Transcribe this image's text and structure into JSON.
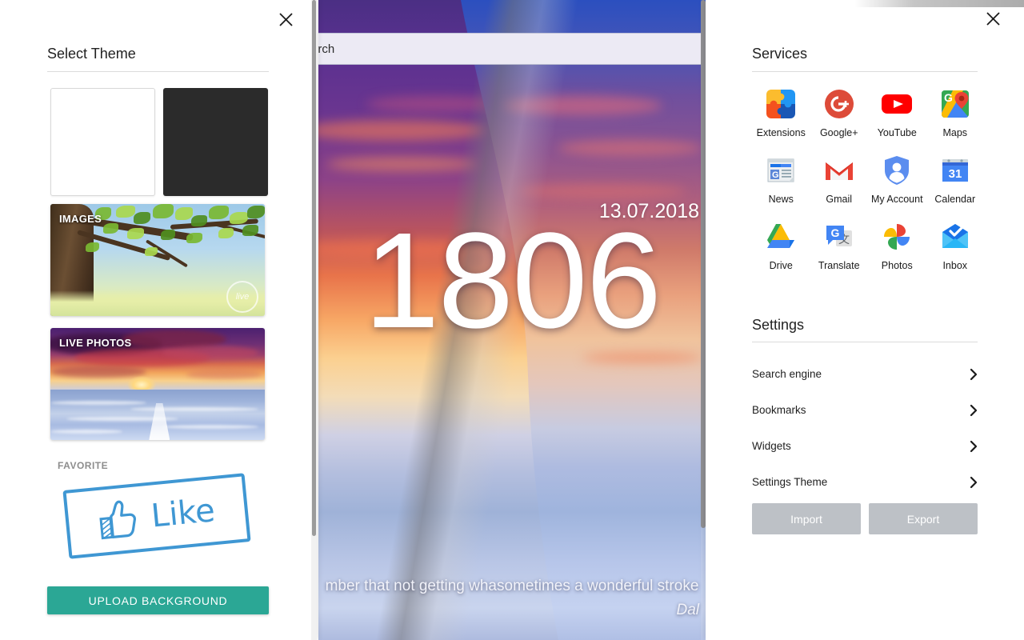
{
  "newtab": {
    "search_placeholder": "arch",
    "date": "13.07.2018",
    "time": "1806",
    "quote": "mber that not getting whasometimes a wonderful stroke",
    "author": "Dal",
    "scrollbar_name": "page-scrollbar"
  },
  "left_panel": {
    "title": "Select Theme",
    "close_label": "✕",
    "themes": [
      {
        "id": "light",
        "label": "",
        "color": "#ffffff"
      },
      {
        "id": "dark",
        "label": "",
        "color": "#2b2b2b"
      }
    ],
    "categories": [
      {
        "id": "images",
        "label": "IMAGES"
      },
      {
        "id": "live-photos",
        "label": "LIVE PHOTOS"
      }
    ],
    "favorite": {
      "label": "FAVORITE",
      "stamp_text": "Like",
      "stamp_color": "#2f8fd0"
    },
    "upload_button": "UPLOAD BACKGROUND",
    "upload_button_color": "#2ba795"
  },
  "right_panel": {
    "close_label": "✕",
    "services_title": "Services",
    "services": [
      {
        "name": "Extensions",
        "icon": "extensions-icon"
      },
      {
        "name": "Google+",
        "icon": "google-plus-icon"
      },
      {
        "name": "YouTube",
        "icon": "youtube-icon"
      },
      {
        "name": "Maps",
        "icon": "maps-icon"
      },
      {
        "name": "News",
        "icon": "news-icon"
      },
      {
        "name": "Gmail",
        "icon": "gmail-icon"
      },
      {
        "name": "My Account",
        "icon": "my-account-icon"
      },
      {
        "name": "Calendar",
        "icon": "calendar-icon"
      },
      {
        "name": "Drive",
        "icon": "drive-icon"
      },
      {
        "name": "Translate",
        "icon": "translate-icon"
      },
      {
        "name": "Photos",
        "icon": "photos-icon"
      },
      {
        "name": "Inbox",
        "icon": "inbox-icon"
      }
    ],
    "settings_title": "Settings",
    "settings": [
      {
        "label": "Search engine"
      },
      {
        "label": "Bookmarks"
      },
      {
        "label": "Widgets"
      },
      {
        "label": "Settings Theme"
      }
    ],
    "import_label": "Import",
    "export_label": "Export",
    "io_button_color": "#bdc1c6"
  }
}
